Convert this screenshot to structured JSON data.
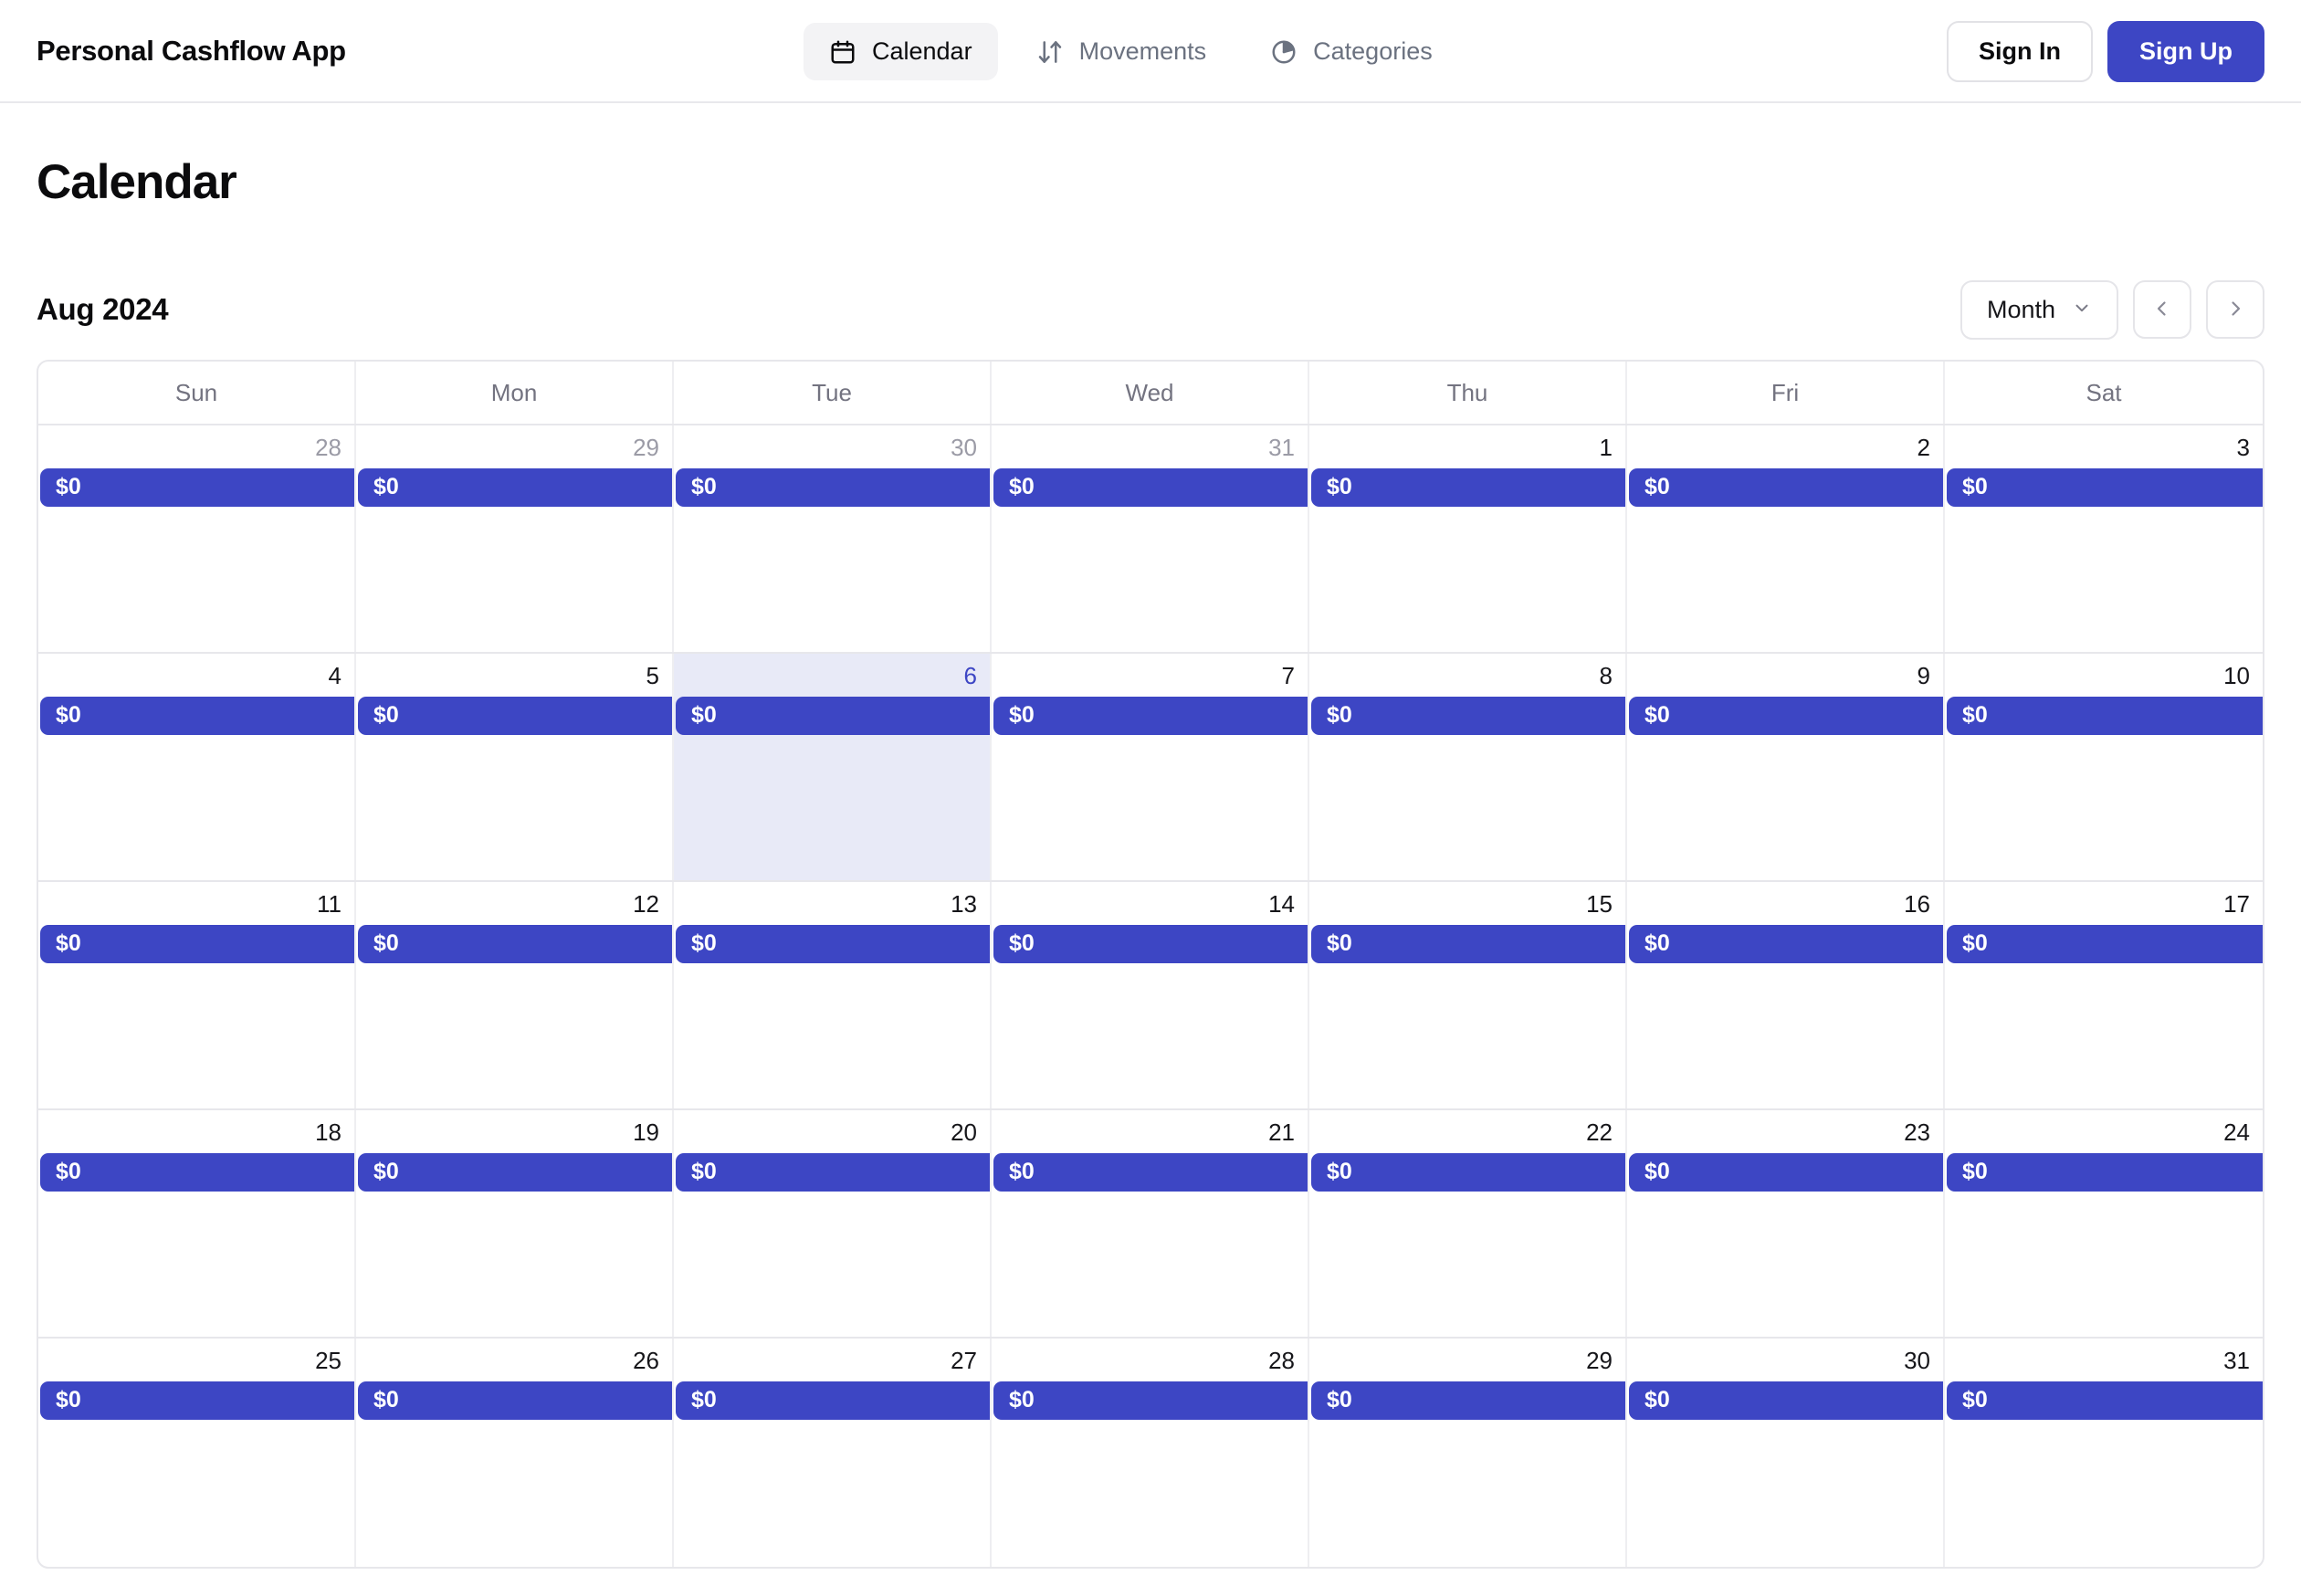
{
  "app": {
    "brand": "Personal Cashflow App"
  },
  "nav": {
    "tabs": [
      {
        "label": "Calendar",
        "icon": "calendar-icon",
        "active": true
      },
      {
        "label": "Movements",
        "icon": "transfer-icon",
        "active": false
      },
      {
        "label": "Categories",
        "icon": "pie-chart-icon",
        "active": false
      }
    ]
  },
  "auth": {
    "sign_in": "Sign In",
    "sign_up": "Sign Up"
  },
  "page": {
    "title": "Calendar"
  },
  "toolbar": {
    "month_label": "Aug 2024",
    "view": "Month",
    "prev_icon": "chevron-left-icon",
    "next_icon": "chevron-right-icon",
    "dropdown_icon": "chevron-down-icon"
  },
  "colors": {
    "accent": "#3d46c4",
    "today_bg": "#e8eaf7",
    "border": "#e7e7eb",
    "muted_text": "#9b9ba6"
  },
  "calendar": {
    "weekdays": [
      "Sun",
      "Mon",
      "Tue",
      "Wed",
      "Thu",
      "Fri",
      "Sat"
    ],
    "amount_label": "$0",
    "weeks": [
      [
        {
          "day": "28",
          "outside": true,
          "today": false,
          "amount": "$0"
        },
        {
          "day": "29",
          "outside": true,
          "today": false,
          "amount": "$0"
        },
        {
          "day": "30",
          "outside": true,
          "today": false,
          "amount": "$0"
        },
        {
          "day": "31",
          "outside": true,
          "today": false,
          "amount": "$0"
        },
        {
          "day": "1",
          "outside": false,
          "today": false,
          "amount": "$0"
        },
        {
          "day": "2",
          "outside": false,
          "today": false,
          "amount": "$0"
        },
        {
          "day": "3",
          "outside": false,
          "today": false,
          "amount": "$0"
        }
      ],
      [
        {
          "day": "4",
          "outside": false,
          "today": false,
          "amount": "$0"
        },
        {
          "day": "5",
          "outside": false,
          "today": false,
          "amount": "$0"
        },
        {
          "day": "6",
          "outside": false,
          "today": true,
          "amount": "$0"
        },
        {
          "day": "7",
          "outside": false,
          "today": false,
          "amount": "$0"
        },
        {
          "day": "8",
          "outside": false,
          "today": false,
          "amount": "$0"
        },
        {
          "day": "9",
          "outside": false,
          "today": false,
          "amount": "$0"
        },
        {
          "day": "10",
          "outside": false,
          "today": false,
          "amount": "$0"
        }
      ],
      [
        {
          "day": "11",
          "outside": false,
          "today": false,
          "amount": "$0"
        },
        {
          "day": "12",
          "outside": false,
          "today": false,
          "amount": "$0"
        },
        {
          "day": "13",
          "outside": false,
          "today": false,
          "amount": "$0"
        },
        {
          "day": "14",
          "outside": false,
          "today": false,
          "amount": "$0"
        },
        {
          "day": "15",
          "outside": false,
          "today": false,
          "amount": "$0"
        },
        {
          "day": "16",
          "outside": false,
          "today": false,
          "amount": "$0"
        },
        {
          "day": "17",
          "outside": false,
          "today": false,
          "amount": "$0"
        }
      ],
      [
        {
          "day": "18",
          "outside": false,
          "today": false,
          "amount": "$0"
        },
        {
          "day": "19",
          "outside": false,
          "today": false,
          "amount": "$0"
        },
        {
          "day": "20",
          "outside": false,
          "today": false,
          "amount": "$0"
        },
        {
          "day": "21",
          "outside": false,
          "today": false,
          "amount": "$0"
        },
        {
          "day": "22",
          "outside": false,
          "today": false,
          "amount": "$0"
        },
        {
          "day": "23",
          "outside": false,
          "today": false,
          "amount": "$0"
        },
        {
          "day": "24",
          "outside": false,
          "today": false,
          "amount": "$0"
        }
      ],
      [
        {
          "day": "25",
          "outside": false,
          "today": false,
          "amount": "$0"
        },
        {
          "day": "26",
          "outside": false,
          "today": false,
          "amount": "$0"
        },
        {
          "day": "27",
          "outside": false,
          "today": false,
          "amount": "$0"
        },
        {
          "day": "28",
          "outside": false,
          "today": false,
          "amount": "$0"
        },
        {
          "day": "29",
          "outside": false,
          "today": false,
          "amount": "$0"
        },
        {
          "day": "30",
          "outside": false,
          "today": false,
          "amount": "$0"
        },
        {
          "day": "31",
          "outside": false,
          "today": false,
          "amount": "$0"
        }
      ]
    ]
  }
}
